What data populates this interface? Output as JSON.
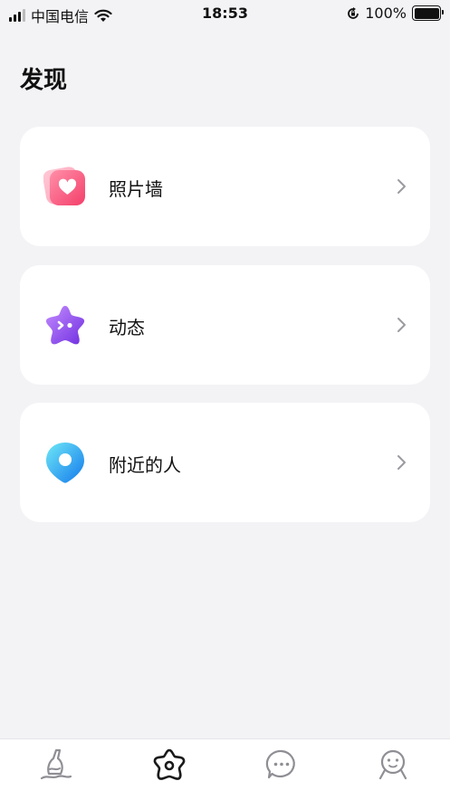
{
  "status_bar": {
    "carrier": "中国电信",
    "time": "18:53",
    "battery_percent": "100%"
  },
  "page": {
    "title": "发现"
  },
  "cards": [
    {
      "label": "照片墙",
      "icon": "heart-photo-icon"
    },
    {
      "label": "动态",
      "icon": "star-creature-icon"
    },
    {
      "label": "附近的人",
      "icon": "location-pin-icon"
    }
  ],
  "tab_bar": {
    "tabs": [
      {
        "icon": "bottle-icon",
        "selected": false
      },
      {
        "icon": "flower-icon",
        "selected": true
      },
      {
        "icon": "chat-bubble-icon",
        "selected": false
      },
      {
        "icon": "profile-face-icon",
        "selected": false
      }
    ]
  },
  "colors": {
    "background": "#f3f3f6",
    "card": "#ffffff",
    "pink_accent": "#ff5c7c",
    "purple_accent": "#8b4cf0",
    "blue_accent": "#1ea8f5"
  }
}
